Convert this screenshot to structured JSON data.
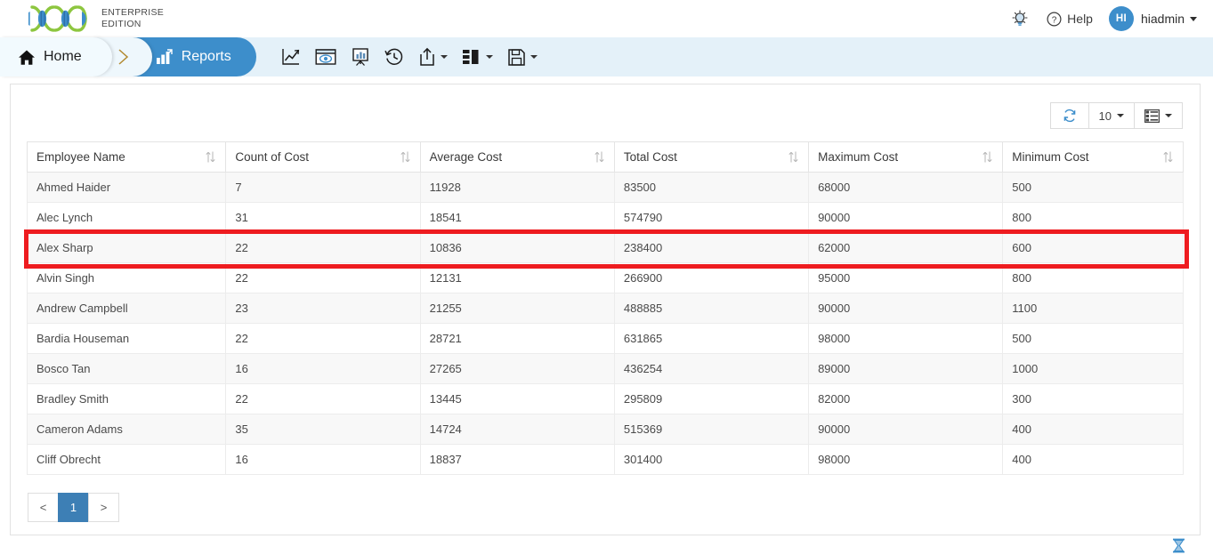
{
  "header": {
    "logo_icon": "dna-helix-logo",
    "product_line1": "ENTERPRISE",
    "product_line2": "EDITION",
    "tips_icon": "lightbulb-icon",
    "help_icon": "question-circle-icon",
    "help_label": "Help",
    "avatar_initials": "HI",
    "user_name": "hiadmin",
    "accent_blue": "#3d8ecb"
  },
  "nav": {
    "breadcrumbs": [
      {
        "label": "Home",
        "icon": "home-icon",
        "active": false
      },
      {
        "label": "Reports",
        "icon": "bar-chart-icon",
        "active": true
      }
    ],
    "separator_icon": "chevron-right-icon",
    "tools": [
      {
        "name": "line-chart-icon",
        "has_caret": false
      },
      {
        "name": "preview-eye-icon",
        "has_caret": false
      },
      {
        "name": "presentation-chart-icon",
        "has_caret": false
      },
      {
        "name": "history-clock-icon",
        "has_caret": false
      },
      {
        "name": "share-export-icon",
        "has_caret": true
      },
      {
        "name": "layout-columns-icon",
        "has_caret": true
      },
      {
        "name": "save-floppy-icon",
        "has_caret": true
      }
    ],
    "bar_background": "#e4f1f9"
  },
  "table_toolbar": {
    "refresh_icon": "refresh-icon",
    "page_size_value": "10",
    "columns_icon": "column-chooser-icon"
  },
  "table": {
    "columns": [
      "Employee Name",
      "Count of Cost",
      "Average Cost",
      "Total Cost",
      "Maximum Cost",
      "Minimum Cost"
    ],
    "sort_icon": "sort-updown-icon",
    "rows": [
      {
        "cells": [
          "Ahmed Haider",
          "7",
          "11928",
          "83500",
          "68000",
          "500"
        ],
        "highlighted": false
      },
      {
        "cells": [
          "Alec Lynch",
          "31",
          "18541",
          "574790",
          "90000",
          "800"
        ],
        "highlighted": false
      },
      {
        "cells": [
          "Alex Sharp",
          "22",
          "10836",
          "238400",
          "62000",
          "600"
        ],
        "highlighted": true
      },
      {
        "cells": [
          "Alvin Singh",
          "22",
          "12131",
          "266900",
          "95000",
          "800"
        ],
        "highlighted": false
      },
      {
        "cells": [
          "Andrew Campbell",
          "23",
          "21255",
          "488885",
          "90000",
          "1100"
        ],
        "highlighted": false
      },
      {
        "cells": [
          "Bardia Houseman",
          "22",
          "28721",
          "631865",
          "98000",
          "500"
        ],
        "highlighted": false
      },
      {
        "cells": [
          "Bosco Tan",
          "16",
          "27265",
          "436254",
          "89000",
          "1000"
        ],
        "highlighted": false
      },
      {
        "cells": [
          "Bradley Smith",
          "22",
          "13445",
          "295809",
          "82000",
          "300"
        ],
        "highlighted": false
      },
      {
        "cells": [
          "Cameron Adams",
          "35",
          "14724",
          "515369",
          "90000",
          "400"
        ],
        "highlighted": false
      },
      {
        "cells": [
          "Cliff Obrecht",
          "16",
          "18837",
          "301400",
          "98000",
          "400"
        ],
        "highlighted": false
      }
    ],
    "highlight_color": "#ee1c20"
  },
  "pagination": {
    "prev_label": "<",
    "next_label": ">",
    "pages": [
      "1"
    ],
    "current_page": "1",
    "active_color": "#3d7fb5"
  },
  "footer": {
    "loading_icon": "hourglass-icon"
  }
}
